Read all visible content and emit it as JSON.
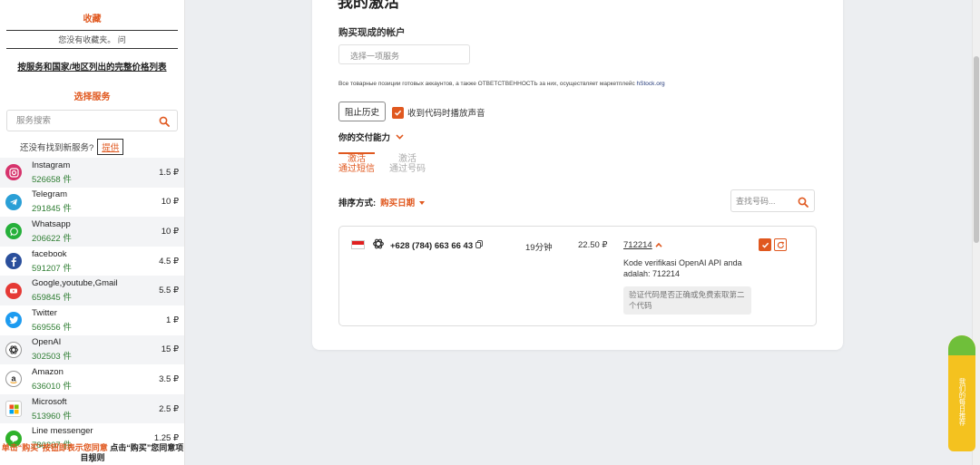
{
  "sidebar": {
    "favorites_title": "收藏",
    "favorites_empty": "您没有收藏夹。 问",
    "price_list_link": "按服务和国家/地区列出的完整价格列表",
    "select_service_title": "选择服务",
    "search_placeholder": "服务搜索",
    "not_found_text": "还没有找到新服务?",
    "suggest_label": "提供",
    "services": [
      {
        "name": "Instagram",
        "count": "526658 件",
        "price": "1.5 ₽",
        "icon": "instagram-icon",
        "color": "#d6336c"
      },
      {
        "name": "Telegram",
        "count": "291845 件",
        "price": "10 ₽",
        "icon": "telegram-icon",
        "color": "#2a9fd6"
      },
      {
        "name": "Whatsapp",
        "count": "206622 件",
        "price": "10 ₽",
        "icon": "whatsapp-icon",
        "color": "#25b03a"
      },
      {
        "name": "facebook",
        "count": "591207 件",
        "price": "4.5 ₽",
        "icon": "facebook-icon",
        "color": "#2a4f9c"
      },
      {
        "name": "Google,youtube,Gmail",
        "count": "659845 件",
        "price": "5.5 ₽",
        "icon": "youtube-icon",
        "color": "#e53935"
      },
      {
        "name": "Twitter",
        "count": "569556 件",
        "price": "1 ₽",
        "icon": "twitter-icon",
        "color": "#1d9bf0"
      },
      {
        "name": "OpenAI",
        "count": "302503 件",
        "price": "15 ₽",
        "icon": "openai-icon",
        "color": "#333333"
      },
      {
        "name": "Amazon",
        "count": "636010 件",
        "price": "3.5 ₽",
        "icon": "amazon-icon",
        "color": "#222222"
      },
      {
        "name": "Microsoft",
        "count": "513960 件",
        "price": "2.5 ₽",
        "icon": "microsoft-icon",
        "color": "#f25022"
      },
      {
        "name": "Line messenger",
        "count": "780207 件",
        "price": "1.25 ₽",
        "icon": "line-icon",
        "color": "#2fb12a"
      }
    ],
    "more_chevron": "⌄",
    "legal_orange": "单击“购买”按钮即表示您同意",
    "legal_dark": "点击“购买”您同意项目规则"
  },
  "main": {
    "title": "我的激活",
    "buy_account_title": "购买现成的帐户",
    "service_select_placeholder": "选择一项服务",
    "notice_text": "Все товарные позиции готовых аккаунтов, а также ОТВЕТСТВЕННОСТЬ за них, осуществляет маркетплейс",
    "notice_link": "hStock.org",
    "history_button": "阻止历史",
    "sound_label": "收到代码时播放声音",
    "ability_label": "你的交付能力",
    "tabs": [
      {
        "line1": "激活",
        "line2": "通过短信",
        "active": true
      },
      {
        "line1": "激活",
        "line2": "通过号码",
        "active": false
      }
    ],
    "sort_label": "排序方式:",
    "sort_value": "购买日期",
    "number_search_placeholder": "查找号码...",
    "order": {
      "phone": "+628 (784) 663 66 43",
      "duration": "19分钟",
      "price": "22.50 ₽",
      "code": "712214",
      "sms": "Kode verifikasi OpenAI API anda adalah: 712214",
      "verify_note": "验证代码是否正确或免费索取第二个代码"
    }
  },
  "widget": {
    "text": "我们的每日推荐"
  },
  "colors": {
    "accent": "#e0581f",
    "success": "#2e7d32"
  }
}
